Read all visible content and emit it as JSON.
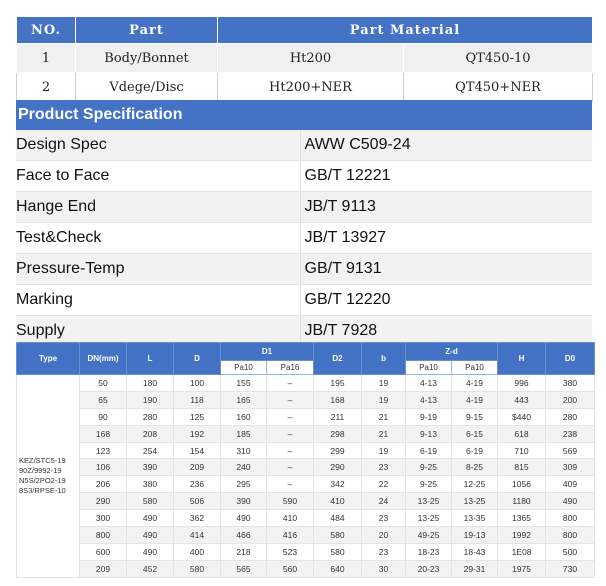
{
  "parts_table": {
    "headers": [
      "NO.",
      "Part",
      "Part Material"
    ],
    "rows": [
      {
        "no": "1",
        "part": "Body/Bonnet",
        "mat1": "Ht200",
        "mat2": "QT450-10"
      },
      {
        "no": "2",
        "part": "Vdege/Disc",
        "mat1": "Ht200+NER",
        "mat2": "QT450+NER"
      }
    ]
  },
  "spec": {
    "title": "Product Specification",
    "rows": [
      {
        "label": "Design Spec",
        "value": "AWW C509-24"
      },
      {
        "label": "Face to Face",
        "value": "GB/T 12221"
      },
      {
        "label": "Hange End",
        "value": "JB/T 9113"
      },
      {
        "label": "Test&Check",
        "value": "JB/T 13927"
      },
      {
        "label": "Pressure-Temp",
        "value": "GB/T 9131"
      },
      {
        "label": "Marking",
        "value": "GB/T 12220"
      },
      {
        "label": "Supply",
        "value": "JB/T 7928"
      }
    ]
  },
  "dim_table": {
    "headers": {
      "type": "Type",
      "dn": "DN(mm)",
      "l": "L",
      "d": "D",
      "d1": "D1",
      "d2": "D2",
      "b": "b",
      "nd": "Z-d",
      "h": "H",
      "d0": "D0"
    },
    "sub_headers": {
      "d1_a": "Pa10",
      "d1_b": "Pa16",
      "nd_a": "Pa10",
      "nd_b": "Pa10"
    },
    "type_lines": [
      "KEZ/STC5-19",
      "90Z/9992-19",
      "N5S/2PO2-19",
      "8S3/RPSE-10"
    ],
    "rows": [
      [
        "50",
        "180",
        "100",
        "155",
        "–",
        "195",
        "19",
        "4-13",
        "4-19",
        "996",
        "380"
      ],
      [
        "65",
        "190",
        "118",
        "165",
        "–",
        "168",
        "19",
        "4-13",
        "4-19",
        "443",
        "200"
      ],
      [
        "90",
        "280",
        "125",
        "160",
        "–",
        "211",
        "21",
        "9-19",
        "9-15",
        "$440",
        "280"
      ],
      [
        "168",
        "208",
        "192",
        "185",
        "–",
        "298",
        "21",
        "9-13",
        "6-15",
        "618",
        "238"
      ],
      [
        "123",
        "254",
        "154",
        "310",
        "–",
        "299",
        "19",
        "6-19",
        "6-19",
        "710",
        "569"
      ],
      [
        "106",
        "390",
        "209",
        "240",
        "–",
        "290",
        "23",
        "9-25",
        "8-25",
        "815",
        "309"
      ],
      [
        "206",
        "380",
        "236",
        "295",
        "–",
        "342",
        "22",
        "9-25",
        "12-25",
        "1056",
        "409"
      ],
      [
        "290",
        "580",
        "506",
        "390",
        "590",
        "410",
        "24",
        "13-25",
        "13-25",
        "1180",
        "490"
      ],
      [
        "300",
        "490",
        "362",
        "490",
        "410",
        "484",
        "23",
        "13-25",
        "13-35",
        "1365",
        "800"
      ],
      [
        "800",
        "490",
        "414",
        "466",
        "416",
        "580",
        "20",
        "49-25",
        "19-13",
        "1992",
        "800"
      ],
      [
        "600",
        "490",
        "400",
        "218",
        "523",
        "580",
        "23",
        "18-23",
        "18-43",
        "1E08",
        "500"
      ],
      [
        "209",
        "452",
        "580",
        "565",
        "560",
        "640",
        "30",
        "20-23",
        "29-31",
        "1975",
        "730"
      ]
    ]
  }
}
